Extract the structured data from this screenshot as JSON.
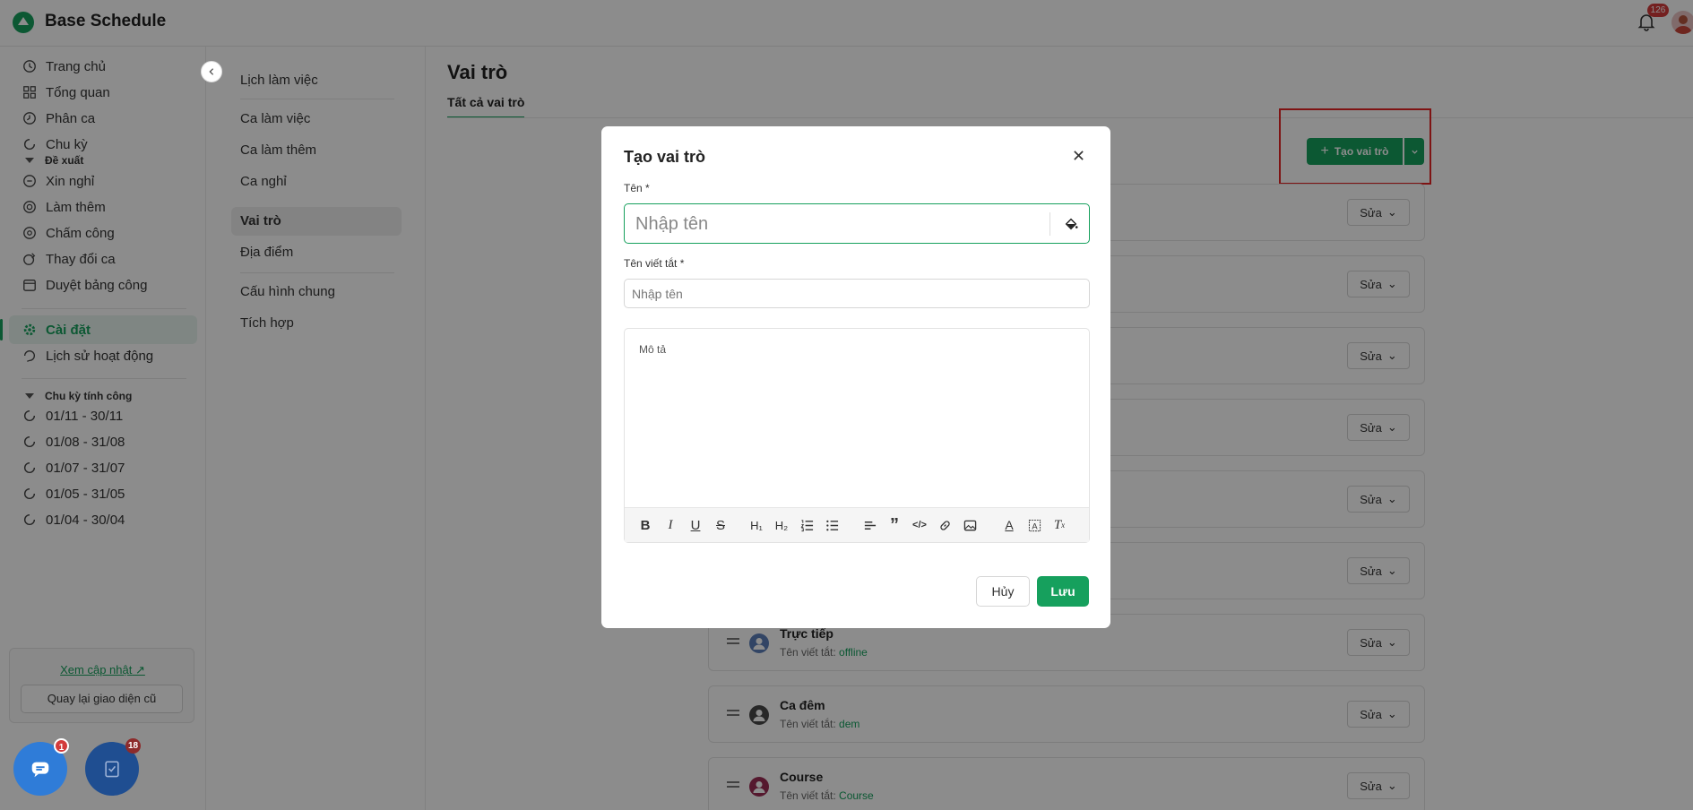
{
  "app": {
    "title": "Base Schedule",
    "notification_count": "126"
  },
  "sidebar": {
    "items": [
      {
        "label": "Trang chủ",
        "icon": "clock-icon"
      },
      {
        "label": "Tổng quan",
        "icon": "grid-icon"
      },
      {
        "label": "Phân ca",
        "icon": "clock-icon"
      },
      {
        "label": "Chu kỳ",
        "icon": "cycle-icon"
      }
    ],
    "proposals_title": "Đề xuất",
    "proposals": [
      {
        "label": "Xin nghỉ"
      },
      {
        "label": "Làm thêm"
      },
      {
        "label": "Chấm công"
      },
      {
        "label": "Thay đổi ca"
      },
      {
        "label": "Duyệt bảng công"
      }
    ],
    "settings_label": "Cài đặt",
    "history_label": "Lịch sử hoạt động",
    "pay_cycle_title": "Chu kỳ tính công",
    "pay_cycles": [
      "01/11 - 30/11",
      "01/08 - 31/08",
      "01/07 - 31/07",
      "01/05 - 31/05",
      "01/04 - 30/04"
    ],
    "update_link": "Xem cập nhật",
    "old_ui_button": "Quay lại giao diện cũ"
  },
  "fab": {
    "chat_badge": "1",
    "task_badge": "18"
  },
  "subnav": {
    "items": [
      "Lịch làm việc",
      "Ca làm việc",
      "Ca làm thêm",
      "Ca nghỉ",
      "Vai trò",
      "Địa điểm",
      "Cấu hình chung",
      "Tích hợp"
    ],
    "active": "Vai trò"
  },
  "content": {
    "title": "Vai trò",
    "tab": "Tất cả vai trò",
    "create_button": "Tạo vai trò",
    "abbr_prefix": "Tên viết tắt:",
    "edit_label": "Sửa",
    "roles": [
      {
        "name": "Trực tiếp",
        "abbr": "offline",
        "color": "#5b7fb8"
      },
      {
        "name": "Ca đêm",
        "abbr": "dem",
        "color": "#4a4a4a"
      },
      {
        "name": "Course",
        "abbr": "Course",
        "color": "#9b2c55"
      }
    ]
  },
  "modal": {
    "title": "Tạo vai trò",
    "name_label": "Tên *",
    "name_placeholder": "Nhập tên",
    "abbr_label": "Tên viết tắt *",
    "abbr_placeholder": "Nhập tên",
    "description_placeholder": "Mô tả",
    "cancel": "Hủy",
    "save": "Lưu"
  },
  "colors": {
    "accent": "#16a05d",
    "highlight": "#e52424"
  }
}
